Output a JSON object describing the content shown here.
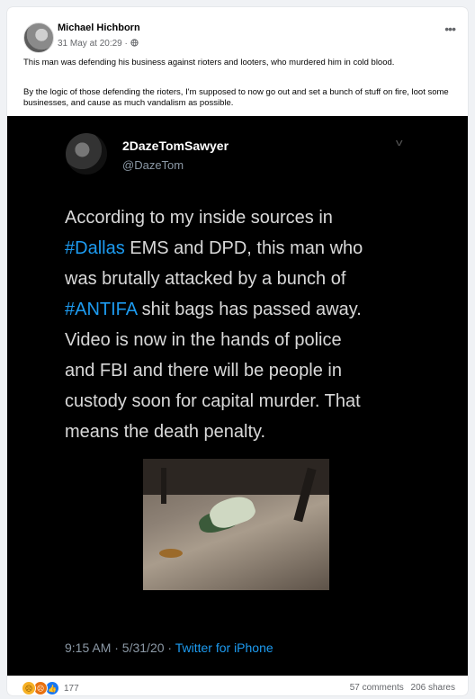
{
  "post": {
    "author": "Michael Hichborn",
    "timestamp": "31 May at 20:29 ·",
    "privacy_icon": "globe-icon",
    "paragraph1": "This man was defending his business against rioters and looters, who murdered him in cold blood.",
    "paragraph2": "By the logic of those defending the rioters, I'm supposed to now go out and set a bunch of stuff on fire, loot some businesses, and cause as much vandalism as possible."
  },
  "tweet": {
    "name": "2DazeTomSawyer",
    "handle": "@DazeTom",
    "lines": [
      {
        "pre": "According to my inside sources in",
        "tag": "",
        "post": ""
      },
      {
        "pre": "",
        "tag": "#Dallas",
        "post": " EMS and DPD, this man who"
      },
      {
        "pre": "was brutally attacked by a bunch of",
        "tag": "",
        "post": ""
      },
      {
        "pre": "",
        "tag": "#ANTIFA",
        "post": " shit bags has passed away."
      },
      {
        "pre": "Video is now in the hands of police",
        "tag": "",
        "post": ""
      },
      {
        "pre": "and FBI and there will be people in",
        "tag": "",
        "post": ""
      },
      {
        "pre": "custody soon for capital murder. That",
        "tag": "",
        "post": ""
      },
      {
        "pre": "means the death penalty.",
        "tag": "",
        "post": ""
      }
    ],
    "time": "9:15 AM · 5/31/20 · ",
    "via": "Twitter for iPhone"
  },
  "engagement": {
    "reaction_icons": [
      "sad-icon",
      "angry-icon",
      "like-icon"
    ],
    "reaction_count": "177",
    "comments": "57 comments",
    "shares": "206 shares"
  },
  "colors": {
    "link_blue": "#1d9bf0",
    "facebook_blue": "#1877f2",
    "tweet_bg": "#000000"
  }
}
